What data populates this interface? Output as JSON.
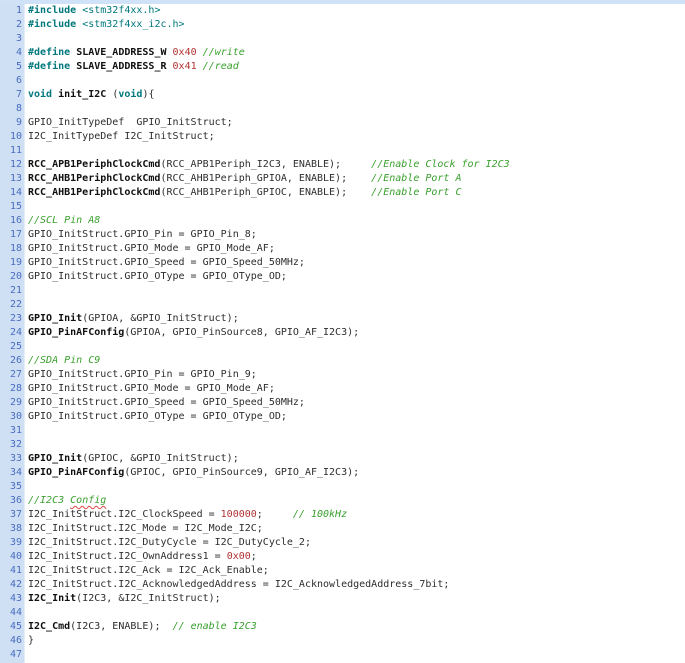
{
  "theme": {
    "background": "#ffffff",
    "top_strip": "#cfe2f8",
    "gutter_bg": "#cfe0f4",
    "line_number": "#4a6cc0",
    "keyword": "#00787c",
    "include": "#00787c",
    "plain": "#2d2d2d",
    "function_bold": "#101010",
    "number": "#b03232",
    "comment": "#3aa02e",
    "squiggle": "#e04545"
  },
  "editor": {
    "language": "c",
    "first_line": 1,
    "last_line": 47,
    "lines": [
      {
        "no": 1,
        "t": [
          [
            "k",
            "#include"
          ],
          [
            "p",
            " "
          ],
          [
            "i",
            "<stm32f4xx.h>"
          ]
        ]
      },
      {
        "no": 2,
        "t": [
          [
            "k",
            "#include"
          ],
          [
            "p",
            " "
          ],
          [
            "i",
            "<stm32f4xx_i2c.h>"
          ]
        ]
      },
      {
        "no": 3,
        "t": []
      },
      {
        "no": 4,
        "t": [
          [
            "k",
            "#define"
          ],
          [
            "p",
            " "
          ],
          [
            "d",
            "SLAVE_ADDRESS_W"
          ],
          [
            "p",
            " "
          ],
          [
            "n",
            "0x40"
          ],
          [
            "p",
            " "
          ],
          [
            "c",
            "//write"
          ]
        ]
      },
      {
        "no": 5,
        "t": [
          [
            "k",
            "#define"
          ],
          [
            "p",
            " "
          ],
          [
            "d",
            "SLAVE_ADDRESS_R"
          ],
          [
            "p",
            " "
          ],
          [
            "n",
            "0x41"
          ],
          [
            "p",
            " "
          ],
          [
            "c",
            "//read"
          ]
        ]
      },
      {
        "no": 6,
        "t": []
      },
      {
        "no": 7,
        "t": [
          [
            "k",
            "void"
          ],
          [
            "p",
            " "
          ],
          [
            "f",
            "init_I2C"
          ],
          [
            "p",
            " ("
          ],
          [
            "k",
            "void"
          ],
          [
            "p",
            "){"
          ]
        ]
      },
      {
        "no": 8,
        "t": []
      },
      {
        "no": 9,
        "t": [
          [
            "p",
            "GPIO_InitTypeDef  GPIO_InitStruct;"
          ]
        ]
      },
      {
        "no": 10,
        "t": [
          [
            "p",
            "I2C_InitTypeDef I2C_InitStruct;"
          ]
        ]
      },
      {
        "no": 11,
        "t": []
      },
      {
        "no": 12,
        "t": [
          [
            "f",
            "RCC_APB1PeriphClockCmd"
          ],
          [
            "p",
            "(RCC_APB1Periph_I2C3, ENABLE);     "
          ],
          [
            "c",
            "//Enable Clock for I2C3"
          ]
        ]
      },
      {
        "no": 13,
        "t": [
          [
            "f",
            "RCC_AHB1PeriphClockCmd"
          ],
          [
            "p",
            "(RCC_AHB1Periph_GPIOA, ENABLE);    "
          ],
          [
            "c",
            "//Enable Port A"
          ]
        ]
      },
      {
        "no": 14,
        "t": [
          [
            "f",
            "RCC_AHB1PeriphClockCmd"
          ],
          [
            "p",
            "(RCC_AHB1Periph_GPIOC, ENABLE);    "
          ],
          [
            "c",
            "//Enable Port C"
          ]
        ]
      },
      {
        "no": 15,
        "t": []
      },
      {
        "no": 16,
        "t": [
          [
            "c",
            "//SCL Pin A8"
          ]
        ]
      },
      {
        "no": 17,
        "t": [
          [
            "p",
            "GPIO_InitStruct.GPIO_Pin = GPIO_Pin_8;"
          ]
        ]
      },
      {
        "no": 18,
        "t": [
          [
            "p",
            "GPIO_InitStruct.GPIO_Mode = GPIO_Mode_AF;"
          ]
        ]
      },
      {
        "no": 19,
        "t": [
          [
            "p",
            "GPIO_InitStruct.GPIO_Speed = GPIO_Speed_50MHz;"
          ]
        ]
      },
      {
        "no": 20,
        "t": [
          [
            "p",
            "GPIO_InitStruct.GPIO_OType = GPIO_OType_OD;"
          ]
        ]
      },
      {
        "no": 21,
        "t": []
      },
      {
        "no": 22,
        "t": []
      },
      {
        "no": 23,
        "t": [
          [
            "f",
            "GPIO_Init"
          ],
          [
            "p",
            "(GPIOA, &GPIO_InitStruct);"
          ]
        ]
      },
      {
        "no": 24,
        "t": [
          [
            "f",
            "GPIO_PinAFConfig"
          ],
          [
            "p",
            "(GPIOA, GPIO_PinSource8, GPIO_AF_I2C3);"
          ]
        ]
      },
      {
        "no": 25,
        "t": []
      },
      {
        "no": 26,
        "t": [
          [
            "c",
            "//SDA Pin C9"
          ]
        ]
      },
      {
        "no": 27,
        "t": [
          [
            "p",
            "GPIO_InitStruct.GPIO_Pin = GPIO_Pin_9;"
          ]
        ]
      },
      {
        "no": 28,
        "t": [
          [
            "p",
            "GPIO_InitStruct.GPIO_Mode = GPIO_Mode_AF;"
          ]
        ]
      },
      {
        "no": 29,
        "t": [
          [
            "p",
            "GPIO_InitStruct.GPIO_Speed = GPIO_Speed_50MHz;"
          ]
        ]
      },
      {
        "no": 30,
        "t": [
          [
            "p",
            "GPIO_InitStruct.GPIO_OType = GPIO_OType_OD;"
          ]
        ]
      },
      {
        "no": 31,
        "t": []
      },
      {
        "no": 32,
        "t": []
      },
      {
        "no": 33,
        "t": [
          [
            "f",
            "GPIO_Init"
          ],
          [
            "p",
            "(GPIOC, &GPIO_InitStruct);"
          ]
        ]
      },
      {
        "no": 34,
        "t": [
          [
            "f",
            "GPIO_PinAFConfig"
          ],
          [
            "p",
            "(GPIOC, GPIO_PinSource9, GPIO_AF_I2C3);"
          ]
        ]
      },
      {
        "no": 35,
        "t": []
      },
      {
        "no": 36,
        "t": [
          [
            "c",
            "//I2C3 "
          ],
          [
            "cw",
            "Config"
          ]
        ]
      },
      {
        "no": 37,
        "t": [
          [
            "p",
            "I2C_InitStruct.I2C_ClockSpeed = "
          ],
          [
            "n",
            "100000"
          ],
          [
            "p",
            ";     "
          ],
          [
            "c",
            "// 100kHz"
          ]
        ]
      },
      {
        "no": 38,
        "t": [
          [
            "p",
            "I2C_InitStruct.I2C_Mode = I2C_Mode_I2C;"
          ]
        ]
      },
      {
        "no": 39,
        "t": [
          [
            "p",
            "I2C_InitStruct.I2C_DutyCycle = I2C_DutyCycle_2;"
          ]
        ]
      },
      {
        "no": 40,
        "t": [
          [
            "p",
            "I2C_InitStruct.I2C_OwnAddress1 = "
          ],
          [
            "n",
            "0x00"
          ],
          [
            "p",
            ";"
          ]
        ]
      },
      {
        "no": 41,
        "t": [
          [
            "p",
            "I2C_InitStruct.I2C_Ack = I2C_Ack_Enable;"
          ]
        ]
      },
      {
        "no": 42,
        "t": [
          [
            "p",
            "I2C_InitStruct.I2C_AcknowledgedAddress = I2C_AcknowledgedAddress_7bit;"
          ]
        ]
      },
      {
        "no": 43,
        "t": [
          [
            "f",
            "I2C_Init"
          ],
          [
            "p",
            "(I2C3, &I2C_InitStruct);"
          ]
        ]
      },
      {
        "no": 44,
        "t": []
      },
      {
        "no": 45,
        "t": [
          [
            "f",
            "I2C_Cmd"
          ],
          [
            "p",
            "(I2C3, ENABLE);  "
          ],
          [
            "c",
            "// enable I2C3"
          ]
        ]
      },
      {
        "no": 46,
        "t": [
          [
            "p",
            "}"
          ]
        ]
      },
      {
        "no": 47,
        "t": []
      }
    ]
  }
}
